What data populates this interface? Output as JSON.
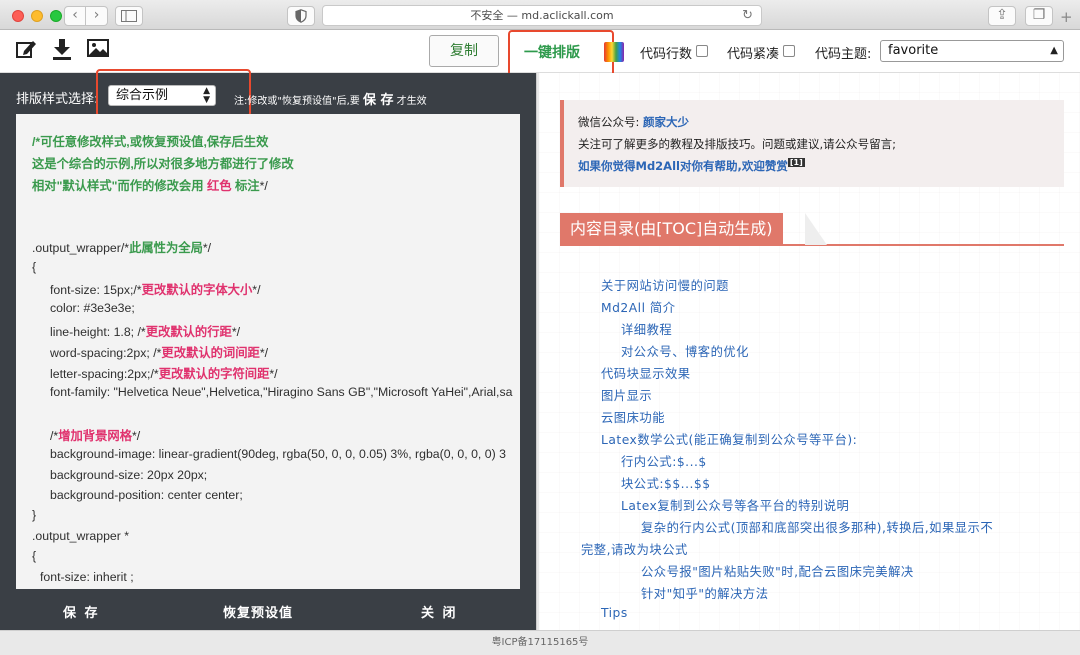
{
  "browser": {
    "url_text": "不安全 — md.aclickall.com"
  },
  "toolbar": {
    "copy_label": "复制",
    "typeset_label": "一键排版",
    "line_numbers_label": "代码行数",
    "compact_label": "代码紧凑",
    "theme_label": "代码主题:",
    "theme_value": "favorite"
  },
  "editor": {
    "style_label": "排版样式选择:",
    "style_value": "综合示例",
    "note_prefix": "注:修改或\"恢复预设值\"后,要",
    "note_save": "保 存",
    "note_suffix": "才生效",
    "code": {
      "l1": "/*可任意修改样式,或恢复预设值,保存后生效",
      "l2": "这是个综合的示例,所以对很多地方都进行了修改",
      "l3a": "相对\"默认样式\"而作的修改会用",
      "l3b": "红色",
      "l3c": "标注",
      "l3d": "*/",
      "l4a": ".output_wrapper/*",
      "l4b": "此属性为全局",
      "l4c": "*/",
      "l5": "{",
      "l6a": "font-size: 15px;/*",
      "l6b": "更改默认的字体大小",
      "l6c": "*/",
      "l7": "color: #3e3e3e;",
      "l8a": "line-height: 1.8; /*",
      "l8b": "更改默认的行距",
      "l8c": "*/",
      "l9a": "word-spacing:2px; /*",
      "l9b": "更改默认的词间距",
      "l9c": "*/",
      "l10a": "letter-spacing:2px;/*",
      "l10b": "更改默认的字符间距",
      "l10c": "*/",
      "l11": "font-family: \"Helvetica Neue\",Helvetica,\"Hiragino Sans GB\",\"Microsoft YaHei\",Arial,sa",
      "l12a": "/*",
      "l12b": "增加背景网格",
      "l12c": "*/",
      "l13": "background-image: linear-gradient(90deg, rgba(50, 0, 0, 0.05) 3%, rgba(0, 0, 0, 0) 3",
      "l14": "background-size: 20px 20px;",
      "l15": "background-position: center center;",
      "l16": "}",
      "l17": ".output_wrapper *",
      "l18": "{",
      "l19": "font-size: inherit ;"
    },
    "save_label": "保 存",
    "reset_label": "恢复预设值",
    "close_label": "关 闭"
  },
  "preview": {
    "wx_line1_prefix": "微信公众号:",
    "wx_line1_name": "颜家大少",
    "wx_line2": "关注可了解更多的教程及排版技巧。问题或建议,请公众号留言;",
    "wx_line3": "如果你觉得Md2All对你有帮助,欢迎赞赏",
    "wx_ref": "[1]",
    "toc_title": "内容目录(由[TOC]自动生成)",
    "toc": {
      "t1": "关于网站访问慢的问题",
      "t2": "Md2All 简介",
      "t3": "详细教程",
      "t4": "对公众号、博客的优化",
      "t5": "代码块显示效果",
      "t6": "图片显示",
      "t7": "云图床功能",
      "t8": "Latex数学公式(能正确复制到公众号等平台):",
      "t9": "行内公式:$...$",
      "t10": "块公式:$$...$$",
      "t11": "Latex复制到公众号等各平台的特别说明",
      "t12a": "复杂的行内公式(顶部和底部突出很多那种),转换后,如果显示不",
      "t12b": "完整,请改为块公式",
      "t13": "公众号报\"图片粘贴失败\"时,配合云图床完美解决",
      "t14": "针对\"知乎\"的解决方法",
      "t15": "Tips"
    }
  },
  "status": {
    "icp": "粤ICP备17115165号"
  }
}
